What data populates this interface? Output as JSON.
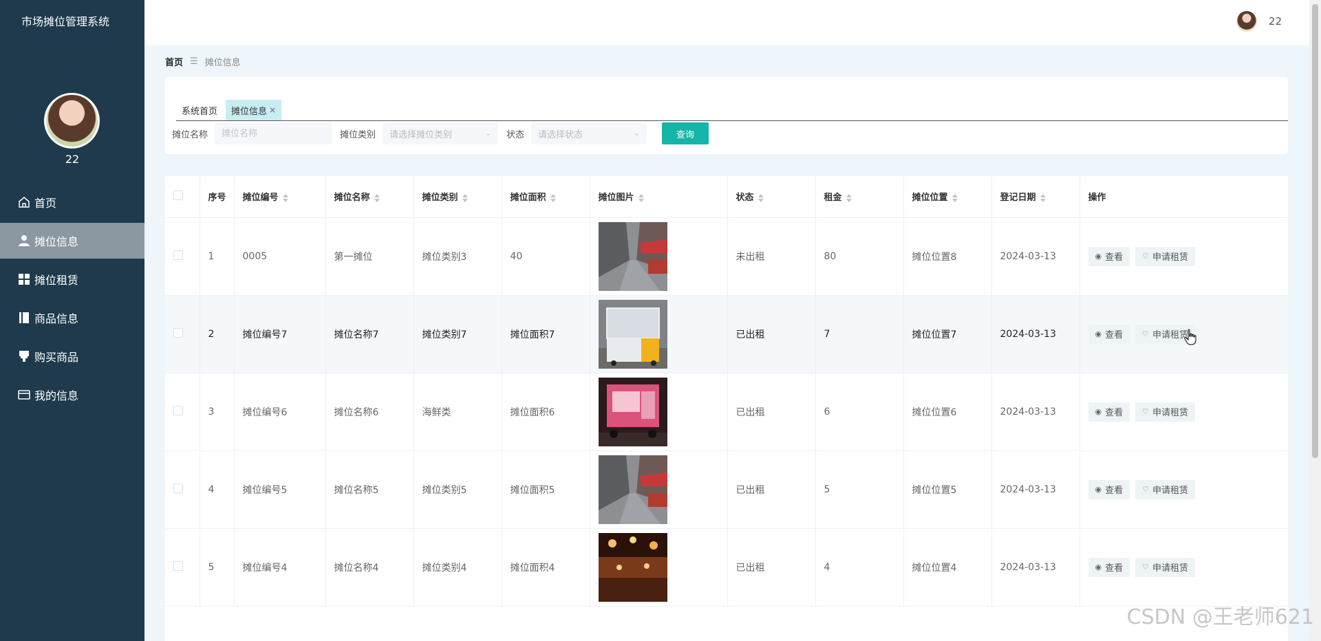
{
  "app": {
    "title": "市场摊位管理系统",
    "user_name": "22"
  },
  "sidebar": {
    "items": [
      {
        "label": "首页",
        "icon": "home-icon",
        "active": false
      },
      {
        "label": "摊位信息",
        "icon": "user-icon",
        "active": true
      },
      {
        "label": "摊位租赁",
        "icon": "grid-icon",
        "active": false
      },
      {
        "label": "商品信息",
        "icon": "book-icon",
        "active": false
      },
      {
        "label": "购买商品",
        "icon": "cart-icon",
        "active": false
      },
      {
        "label": "我的信息",
        "icon": "card-icon",
        "active": false
      }
    ]
  },
  "header": {
    "user_name": "22"
  },
  "breadcrumb": {
    "home": "首页",
    "separator": "☰",
    "current": "摊位信息"
  },
  "tabs": [
    {
      "label": "系统首页",
      "active": false
    },
    {
      "label": "摊位信息",
      "active": true,
      "close": "×"
    }
  ],
  "search": {
    "name_label": "摊位名称",
    "name_placeholder": "摊位名称",
    "category_label": "摊位类别",
    "category_placeholder": "请选择摊位类别",
    "status_label": "状态",
    "status_placeholder": "请选择状态",
    "button": "查询"
  },
  "table": {
    "headers": {
      "index": "序号",
      "code": "摊位编号",
      "name": "摊位名称",
      "category": "摊位类别",
      "area": "摊位面积",
      "image": "摊位图片",
      "status": "状态",
      "rent": "租金",
      "location": "摊位位置",
      "date": "登记日期",
      "actions": "操作"
    },
    "rows": [
      {
        "index": "1",
        "code": "0005",
        "name": "第一摊位",
        "category": "摊位类别3",
        "area": "40",
        "image": "street-photo",
        "status": "未出租",
        "rent": "80",
        "location": "摊位位置8",
        "date": "2024-03-13"
      },
      {
        "index": "2",
        "code": "摊位编号7",
        "name": "摊位名称7",
        "category": "摊位类别7",
        "area": "摊位面积7",
        "image": "cart-photo",
        "status": "已出租",
        "rent": "7",
        "location": "摊位位置7",
        "date": "2024-03-13"
      },
      {
        "index": "3",
        "code": "摊位编号6",
        "name": "摊位名称6",
        "category": "海鲜类",
        "area": "摊位面积6",
        "image": "pink-stall-photo",
        "status": "已出租",
        "rent": "6",
        "location": "摊位位置6",
        "date": "2024-03-13"
      },
      {
        "index": "4",
        "code": "摊位编号5",
        "name": "摊位名称5",
        "category": "摊位类别5",
        "area": "摊位面积5",
        "image": "street-photo",
        "status": "已出租",
        "rent": "5",
        "location": "摊位位置5",
        "date": "2024-03-13"
      },
      {
        "index": "5",
        "code": "摊位编号4",
        "name": "摊位名称4",
        "category": "摊位类别4",
        "area": "摊位面积4",
        "image": "night-market-photo",
        "status": "已出租",
        "rent": "4",
        "location": "摊位位置4",
        "date": "2024-03-13"
      }
    ],
    "view_label": "查看",
    "rent_label": "申请租赁"
  },
  "watermark": "CSDN @王老师621",
  "colors": {
    "sidebar": "#1e3a4c",
    "accent": "#15b5a8",
    "active_item": "#8b98a2",
    "active_tab": "#c8eef2"
  }
}
